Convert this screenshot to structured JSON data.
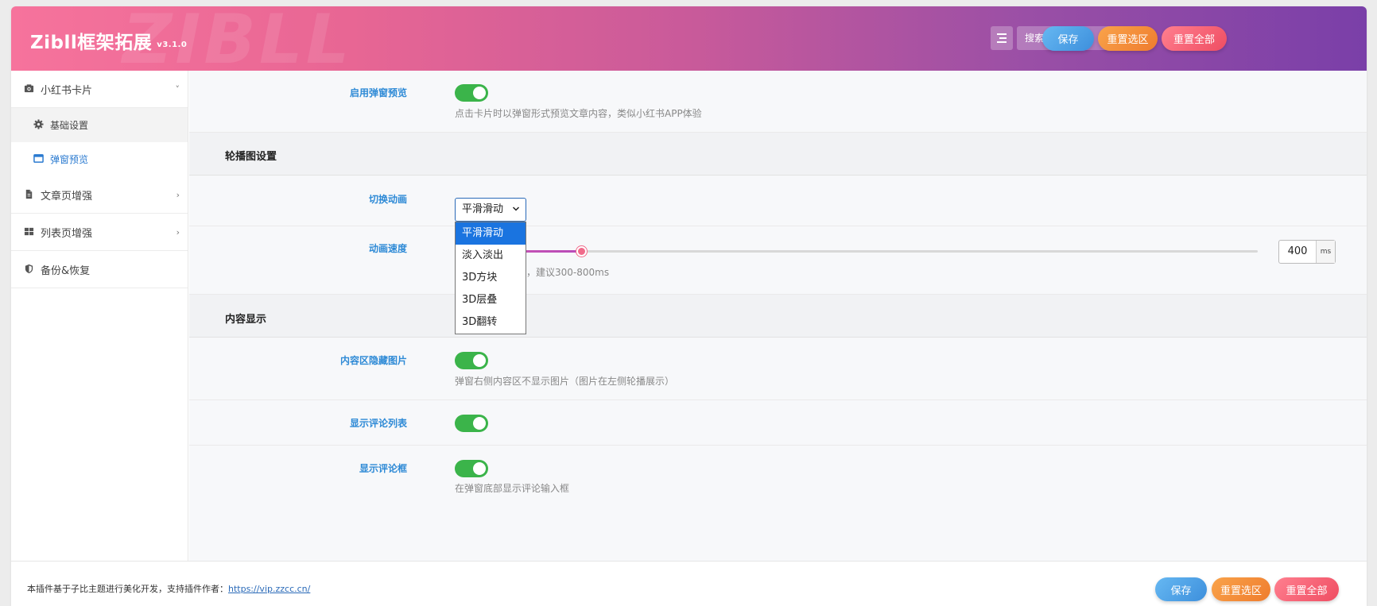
{
  "header": {
    "brand": "Zibll框架拓展",
    "version": "v3.1.0",
    "watermark": "ZIBLL",
    "search_placeholder": "搜索...",
    "save_label": "保存",
    "reset_section_label": "重置选区",
    "reset_all_label": "重置全部"
  },
  "sidebar": {
    "items": [
      {
        "label": "小红书卡片",
        "icon": "camera-icon",
        "chevron": "˅",
        "children": [
          {
            "label": "基础设置",
            "icon": "gear-icon"
          },
          {
            "label": "弹窗预览",
            "icon": "window-icon"
          }
        ]
      },
      {
        "label": "文章页增强",
        "icon": "file-icon",
        "chevron": "›"
      },
      {
        "label": "列表页增强",
        "icon": "grid-icon",
        "chevron": "›"
      },
      {
        "label": "备份&恢复",
        "icon": "shield-icon"
      }
    ]
  },
  "main": {
    "popup_preview": {
      "label": "启用弹窗预览",
      "enabled": true,
      "desc": "点击卡片时以弹窗形式预览文章内容，类似小红书APP体验"
    },
    "carousel_section": "轮播图设置",
    "transition": {
      "label": "切换动画",
      "value": "平滑滑动",
      "options": [
        "平滑滑动",
        "淡入淡出",
        "3D方块",
        "3D层叠",
        "3D翻转"
      ]
    },
    "speed": {
      "label": "动画速度",
      "value": "400",
      "unit": "ms",
      "desc": "慢，建议300-800ms",
      "min": 100,
      "max": 2000
    },
    "content_section": "内容显示",
    "hide_images": {
      "label": "内容区隐藏图片",
      "enabled": true,
      "desc": "弹窗右侧内容区不显示图片（图片在左侧轮播展示）"
    },
    "show_comments": {
      "label": "显示评论列表",
      "enabled": true
    },
    "show_comment_box": {
      "label": "显示评论框",
      "enabled": true,
      "desc": "在弹窗底部显示评论输入框"
    }
  },
  "footer": {
    "text": "本插件基于子比主题进行美化开发，支持插件作者：",
    "link": "https://vip.zzcc.cn/",
    "save_label": "保存",
    "reset_section_label": "重置选区",
    "reset_all_label": "重置全部"
  },
  "colors": {
    "accent_blue": "#2e8ad6",
    "toggle_green": "#3bb44a",
    "header_start": "#f6739c",
    "header_end": "#7a3fa8"
  }
}
